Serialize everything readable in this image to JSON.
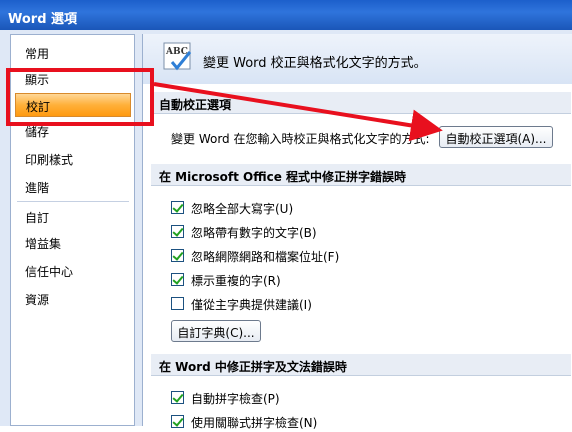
{
  "window": {
    "title": "Word 選項"
  },
  "sidebar": {
    "items": [
      {
        "label": "常用"
      },
      {
        "label": "顯示"
      },
      {
        "label": "校訂"
      },
      {
        "label": "儲存"
      },
      {
        "label": "印刷樣式"
      },
      {
        "label": "進階"
      },
      {
        "label": "自訂"
      },
      {
        "label": "增益集"
      },
      {
        "label": "信任中心"
      },
      {
        "label": "資源"
      }
    ],
    "selected": "校訂"
  },
  "header": {
    "icon": "abc-spellcheck-icon",
    "text": "變更 Word 校正與格式化文字的方式。"
  },
  "autocorrect": {
    "section_title": "自動校正選項",
    "description": "變更 Word 在您輸入時校正與格式化文字的方式:",
    "button_label": "自動校正選項(A)..."
  },
  "office_spelling": {
    "section_title": "在 Microsoft Office 程式中修正拼字錯誤時",
    "options": [
      {
        "label": "忽略全部大寫字(U)",
        "checked": true
      },
      {
        "label": "忽略帶有數字的文字(B)",
        "checked": true
      },
      {
        "label": "忽略網際網路和檔案位址(F)",
        "checked": true
      },
      {
        "label": "標示重複的字(R)",
        "checked": true
      },
      {
        "label": "僅從主字典提供建議(I)",
        "checked": false
      }
    ],
    "custom_dict_button": "自訂字典(C)..."
  },
  "word_spelling": {
    "section_title": "在 Word 中修正拼字及文法錯誤時",
    "options": [
      {
        "label": "自動拼字檢查(P)",
        "checked": true
      },
      {
        "label": "使用關聯式拼字檢查(N)",
        "checked": true
      }
    ]
  },
  "colors": {
    "highlight": "#e8101e",
    "selected_nav": "#ffb03a",
    "titlebar": "#1c5fcb"
  }
}
